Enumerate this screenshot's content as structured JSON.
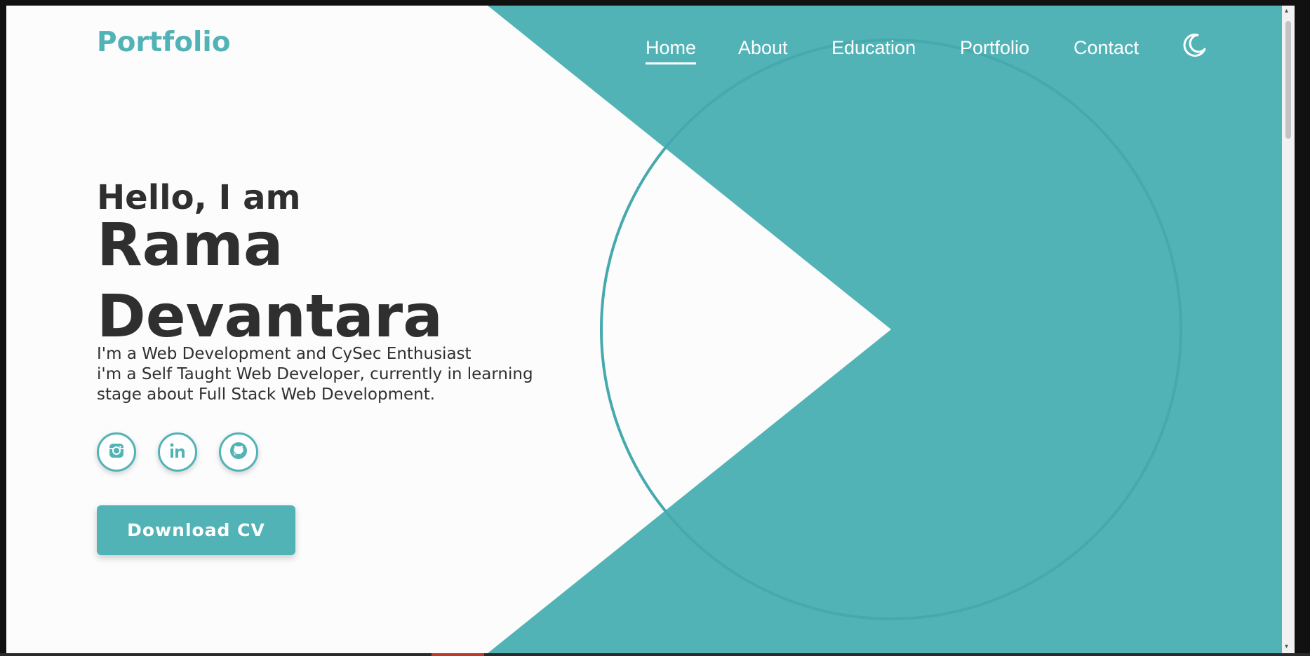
{
  "brand": {
    "logo": "Portfolio",
    "accent_color": "#52b3b7",
    "text_color": "#2f2f2f",
    "background_color": "#fcfcfc"
  },
  "nav": {
    "items": [
      {
        "label": "Home",
        "active": true
      },
      {
        "label": "About",
        "active": false
      },
      {
        "label": "Education",
        "active": false
      },
      {
        "label": "Portfolio",
        "active": false
      },
      {
        "label": "Contact",
        "active": false
      }
    ],
    "theme_toggle_icon": "moon-icon"
  },
  "hero": {
    "greeting": "Hello, I am",
    "name_line1": "Rama",
    "name_line2": "Devantara",
    "desc_line1": "I'm a Web Development and CySec Enthusiast",
    "desc_line2": "i'm a Self Taught Web Developer, currently in learning",
    "desc_line3": "stage about Full Stack Web Development.",
    "socials": [
      {
        "name": "instagram",
        "icon": "instagram-icon"
      },
      {
        "name": "linkedin",
        "icon": "linkedin-icon"
      },
      {
        "name": "github",
        "icon": "github-icon"
      }
    ],
    "cta_label": "Download CV"
  }
}
